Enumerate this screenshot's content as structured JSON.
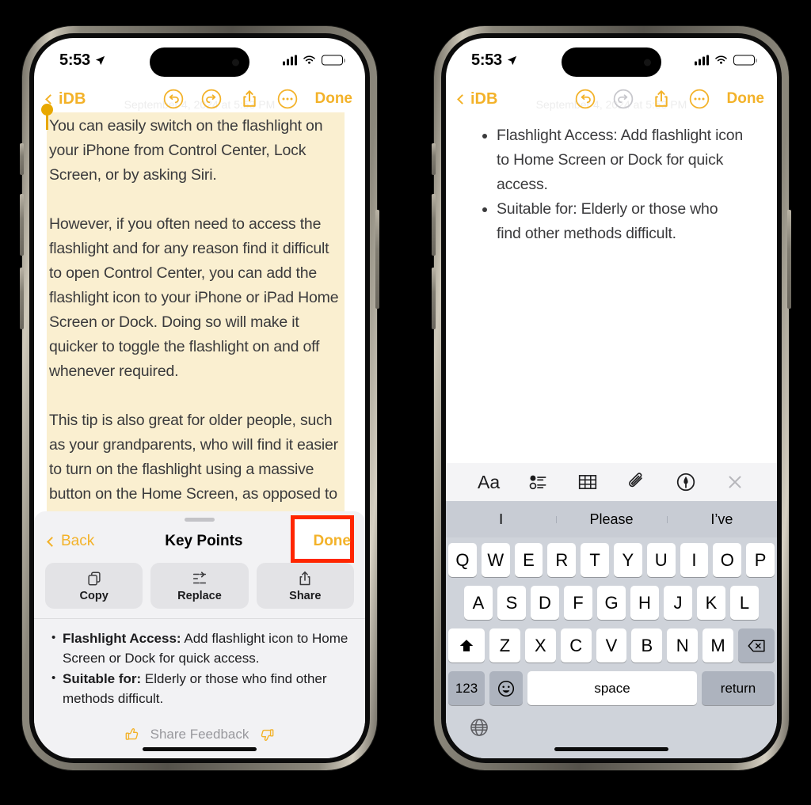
{
  "left_phone": {
    "status_bar": {
      "time": "5:53",
      "location_icon": "location-arrow-icon",
      "cellular": "signal-bars-icon",
      "wifi": "wifi-icon",
      "battery": "battery-icon"
    },
    "nav_bar": {
      "back_label": "iDB",
      "undo_icon": "undo-icon",
      "redo_icon": "redo-icon",
      "share_icon": "share-icon",
      "more_icon": "more-ellipsis-icon",
      "done_label": "Done"
    },
    "note": {
      "date": "September 4, 2024 at 5:53 PM",
      "paragraphs": [
        "You can easily switch on the flashlight on your iPhone from Control Center, Lock Screen, or by asking Siri.",
        "However, if you often need to access the flashlight and for any reason find it difficult to open Control Center, you can add the flashlight icon to your iPhone or iPad Home Screen or Dock. Doing so will make it quicker to toggle the flashlight on and off whenever required.",
        "This tip is also great for older people, such as your grandparents, who will find it easier to turn on the flashlight using a massive button on the Home Screen, as opposed to other methods."
      ],
      "highlight_color": "#FAEFD0",
      "selection_handle_color": "#E8A800"
    },
    "sheet": {
      "back_label": "Back",
      "title": "Key Points",
      "done_label": "Done",
      "highlight_box_color": "#FF2600",
      "actions": [
        {
          "label": "Copy",
          "icon": "copy-icon"
        },
        {
          "label": "Replace",
          "icon": "replace-icon"
        },
        {
          "label": "Share",
          "icon": "share-icon"
        }
      ],
      "key_points": [
        {
          "bold": "Flashlight Access:",
          "rest": " Add flashlight icon to Home Screen or Dock for quick access."
        },
        {
          "bold": "Suitable for:",
          "rest": " Elderly or those who find other methods difficult."
        }
      ],
      "feedback": {
        "label": "Share Feedback",
        "thumbs_up_icon": "thumbs-up-icon",
        "thumbs_down_icon": "thumbs-down-icon"
      }
    }
  },
  "right_phone": {
    "status_bar": {
      "time": "5:53",
      "location_icon": "location-arrow-icon",
      "cellular": "signal-bars-icon",
      "wifi": "wifi-icon",
      "battery": "battery-icon"
    },
    "nav_bar": {
      "back_label": "iDB",
      "undo_icon": "undo-icon",
      "redo_icon": "redo-icon-disabled",
      "share_icon": "share-icon",
      "more_icon": "more-ellipsis-icon",
      "done_label": "Done"
    },
    "note": {
      "date": "September 4, 2024 at 5:53 PM",
      "bullets": [
        "Flashlight Access: Add flashlight icon to Home Screen or Dock for quick access.",
        "Suitable for: Elderly or those who find other methods difficult."
      ]
    },
    "format_toolbar": [
      {
        "icon": "text-format-aa-icon",
        "label": "Aa"
      },
      {
        "icon": "checklist-icon",
        "label": ""
      },
      {
        "icon": "table-icon",
        "label": ""
      },
      {
        "icon": "paperclip-icon",
        "label": ""
      },
      {
        "icon": "markup-pen-icon",
        "label": ""
      },
      {
        "icon": "close-x-icon",
        "label": ""
      }
    ],
    "predictions": [
      "I",
      "Please",
      "I’ve"
    ],
    "keyboard": {
      "row1": [
        "Q",
        "W",
        "E",
        "R",
        "T",
        "Y",
        "U",
        "I",
        "O",
        "P"
      ],
      "row2": [
        "A",
        "S",
        "D",
        "F",
        "G",
        "H",
        "J",
        "K",
        "L"
      ],
      "row3": [
        "Z",
        "X",
        "C",
        "V",
        "B",
        "N",
        "M"
      ],
      "shift_icon": "shift-icon",
      "backspace_icon": "backspace-icon",
      "numbers_label": "123",
      "emoji_icon": "emoji-icon",
      "space_label": "space",
      "return_label": "return",
      "globe_icon": "globe-icon"
    }
  },
  "theme": {
    "accent_yellow": "#F3B229",
    "highlight_yellow": "#FAEFD0",
    "sheet_bg": "#F2F2F4",
    "keyboard_bg": "#CFD3DA",
    "prediction_bg": "#C8CCD4",
    "red_annotation": "#FF2600"
  }
}
